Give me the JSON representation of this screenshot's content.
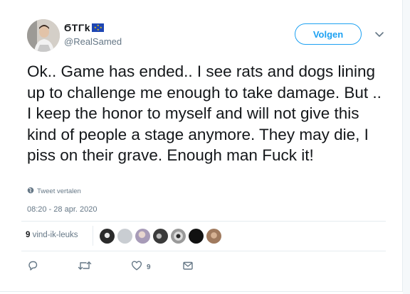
{
  "profile": {
    "display_name": "ϬΤΓk",
    "handle": "@RealSamed",
    "flag_icon": "eu-flag-icon",
    "follow_label": "Volgen"
  },
  "tweet": {
    "text": "Ok.. Game has ended.. I see rats and dogs lining up to challenge me enough to take damage. But .. I keep the honor to myself and will not give this kind of people a stage anymore. They may die, I piss on their grave. Enough man Fuck it!",
    "translate_label": "Tweet vertalen",
    "timestamp": "08:20 - 28 apr. 2020"
  },
  "likes": {
    "count": "9",
    "label": "vind-ik-leuks",
    "liker_colors": [
      "#2b2b2b",
      "#c9cdd2",
      "#a79bb8",
      "#3a3a3a",
      "#9a9a9a",
      "#111111",
      "#a07a5e"
    ]
  },
  "actions": {
    "reply_icon": "reply-icon",
    "retweet_icon": "retweet-icon",
    "like_icon": "heart-icon",
    "like_count": "9",
    "dm_icon": "mail-icon"
  },
  "colors": {
    "accent": "#1da1f2",
    "secondary_text": "#657786",
    "primary_text": "#14171a"
  }
}
